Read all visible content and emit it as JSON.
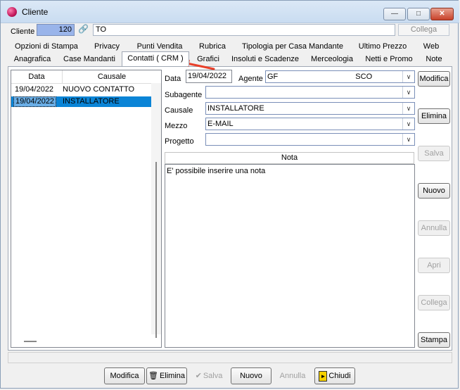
{
  "window": {
    "title": "Cliente"
  },
  "cliente": {
    "label": "Cliente",
    "code": "120",
    "name": "TO",
    "collega_label": "Collega"
  },
  "tabs_row1": [
    "Opzioni di Stampa",
    "Privacy",
    "Punti Vendita",
    "Rubrica",
    "Tipologia per Casa Mandante",
    "Ultimo Prezzo",
    "Web"
  ],
  "tabs_row2": [
    "Anagrafica",
    "Case Mandanti",
    "Contatti ( CRM )",
    "Grafici",
    "Insoluti e Scadenze",
    "Merceologia",
    "Netti e Promo",
    "Note"
  ],
  "list": {
    "headers": {
      "data": "Data",
      "causale": "Causale"
    },
    "rows": [
      {
        "data": "19/04/2022",
        "causale": "NUOVO CONTATTO"
      },
      {
        "data": "19/04/2022",
        "causale": "INSTALLATORE"
      }
    ]
  },
  "form": {
    "data_label": "Data",
    "data_value": "19/04/2022",
    "agente_label": "Agente",
    "agente_value": "GF                                    SCO",
    "subagente_label": "Subagente",
    "subagente_value": "",
    "causale_label": "Causale",
    "causale_value": "INSTALLATORE",
    "mezzo_label": "Mezzo",
    "mezzo_value": "E-MAIL",
    "progetto_label": "Progetto",
    "progetto_value": "",
    "nota_header": "Nota",
    "nota_text": "E' possibile inserire una nota"
  },
  "side_buttons": {
    "modifica": "Modifica",
    "elimina": "Elimina",
    "salva": "Salva",
    "nuovo": "Nuovo",
    "annulla": "Annulla",
    "apri": "Apri",
    "collega": "Collega",
    "stampa": "Stampa"
  },
  "bottom_buttons": {
    "modifica": "Modifica",
    "elimina": "Elimina",
    "salva": "Salva",
    "nuovo": "Nuovo",
    "annulla": "Annulla",
    "chiudi": "Chiudi"
  },
  "colors": {
    "selection": "#0a84d6",
    "code_bg": "#99b4ea",
    "annotation_arrow": "#e8402a"
  }
}
